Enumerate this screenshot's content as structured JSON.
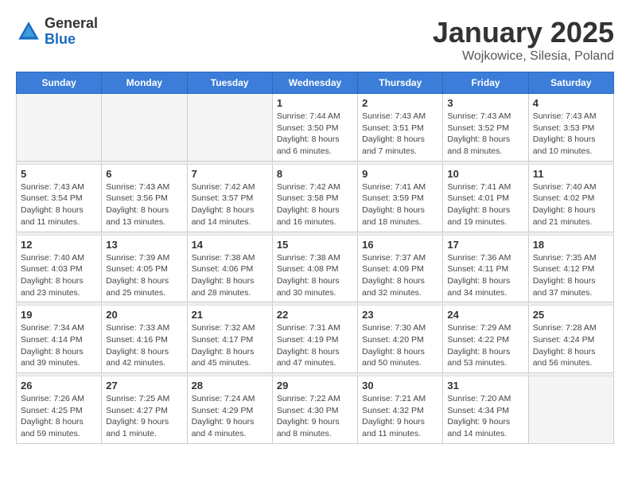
{
  "header": {
    "logo_general": "General",
    "logo_blue": "Blue",
    "month_title": "January 2025",
    "location": "Wojkowice, Silesia, Poland"
  },
  "weekdays": [
    "Sunday",
    "Monday",
    "Tuesday",
    "Wednesday",
    "Thursday",
    "Friday",
    "Saturday"
  ],
  "weeks": [
    [
      {
        "day": "",
        "info": ""
      },
      {
        "day": "",
        "info": ""
      },
      {
        "day": "",
        "info": ""
      },
      {
        "day": "1",
        "info": "Sunrise: 7:44 AM\nSunset: 3:50 PM\nDaylight: 8 hours\nand 6 minutes."
      },
      {
        "day": "2",
        "info": "Sunrise: 7:43 AM\nSunset: 3:51 PM\nDaylight: 8 hours\nand 7 minutes."
      },
      {
        "day": "3",
        "info": "Sunrise: 7:43 AM\nSunset: 3:52 PM\nDaylight: 8 hours\nand 8 minutes."
      },
      {
        "day": "4",
        "info": "Sunrise: 7:43 AM\nSunset: 3:53 PM\nDaylight: 8 hours\nand 10 minutes."
      }
    ],
    [
      {
        "day": "5",
        "info": "Sunrise: 7:43 AM\nSunset: 3:54 PM\nDaylight: 8 hours\nand 11 minutes."
      },
      {
        "day": "6",
        "info": "Sunrise: 7:43 AM\nSunset: 3:56 PM\nDaylight: 8 hours\nand 13 minutes."
      },
      {
        "day": "7",
        "info": "Sunrise: 7:42 AM\nSunset: 3:57 PM\nDaylight: 8 hours\nand 14 minutes."
      },
      {
        "day": "8",
        "info": "Sunrise: 7:42 AM\nSunset: 3:58 PM\nDaylight: 8 hours\nand 16 minutes."
      },
      {
        "day": "9",
        "info": "Sunrise: 7:41 AM\nSunset: 3:59 PM\nDaylight: 8 hours\nand 18 minutes."
      },
      {
        "day": "10",
        "info": "Sunrise: 7:41 AM\nSunset: 4:01 PM\nDaylight: 8 hours\nand 19 minutes."
      },
      {
        "day": "11",
        "info": "Sunrise: 7:40 AM\nSunset: 4:02 PM\nDaylight: 8 hours\nand 21 minutes."
      }
    ],
    [
      {
        "day": "12",
        "info": "Sunrise: 7:40 AM\nSunset: 4:03 PM\nDaylight: 8 hours\nand 23 minutes."
      },
      {
        "day": "13",
        "info": "Sunrise: 7:39 AM\nSunset: 4:05 PM\nDaylight: 8 hours\nand 25 minutes."
      },
      {
        "day": "14",
        "info": "Sunrise: 7:38 AM\nSunset: 4:06 PM\nDaylight: 8 hours\nand 28 minutes."
      },
      {
        "day": "15",
        "info": "Sunrise: 7:38 AM\nSunset: 4:08 PM\nDaylight: 8 hours\nand 30 minutes."
      },
      {
        "day": "16",
        "info": "Sunrise: 7:37 AM\nSunset: 4:09 PM\nDaylight: 8 hours\nand 32 minutes."
      },
      {
        "day": "17",
        "info": "Sunrise: 7:36 AM\nSunset: 4:11 PM\nDaylight: 8 hours\nand 34 minutes."
      },
      {
        "day": "18",
        "info": "Sunrise: 7:35 AM\nSunset: 4:12 PM\nDaylight: 8 hours\nand 37 minutes."
      }
    ],
    [
      {
        "day": "19",
        "info": "Sunrise: 7:34 AM\nSunset: 4:14 PM\nDaylight: 8 hours\nand 39 minutes."
      },
      {
        "day": "20",
        "info": "Sunrise: 7:33 AM\nSunset: 4:16 PM\nDaylight: 8 hours\nand 42 minutes."
      },
      {
        "day": "21",
        "info": "Sunrise: 7:32 AM\nSunset: 4:17 PM\nDaylight: 8 hours\nand 45 minutes."
      },
      {
        "day": "22",
        "info": "Sunrise: 7:31 AM\nSunset: 4:19 PM\nDaylight: 8 hours\nand 47 minutes."
      },
      {
        "day": "23",
        "info": "Sunrise: 7:30 AM\nSunset: 4:20 PM\nDaylight: 8 hours\nand 50 minutes."
      },
      {
        "day": "24",
        "info": "Sunrise: 7:29 AM\nSunset: 4:22 PM\nDaylight: 8 hours\nand 53 minutes."
      },
      {
        "day": "25",
        "info": "Sunrise: 7:28 AM\nSunset: 4:24 PM\nDaylight: 8 hours\nand 56 minutes."
      }
    ],
    [
      {
        "day": "26",
        "info": "Sunrise: 7:26 AM\nSunset: 4:25 PM\nDaylight: 8 hours\nand 59 minutes."
      },
      {
        "day": "27",
        "info": "Sunrise: 7:25 AM\nSunset: 4:27 PM\nDaylight: 9 hours\nand 1 minute."
      },
      {
        "day": "28",
        "info": "Sunrise: 7:24 AM\nSunset: 4:29 PM\nDaylight: 9 hours\nand 4 minutes."
      },
      {
        "day": "29",
        "info": "Sunrise: 7:22 AM\nSunset: 4:30 PM\nDaylight: 9 hours\nand 8 minutes."
      },
      {
        "day": "30",
        "info": "Sunrise: 7:21 AM\nSunset: 4:32 PM\nDaylight: 9 hours\nand 11 minutes."
      },
      {
        "day": "31",
        "info": "Sunrise: 7:20 AM\nSunset: 4:34 PM\nDaylight: 9 hours\nand 14 minutes."
      },
      {
        "day": "",
        "info": ""
      }
    ]
  ]
}
